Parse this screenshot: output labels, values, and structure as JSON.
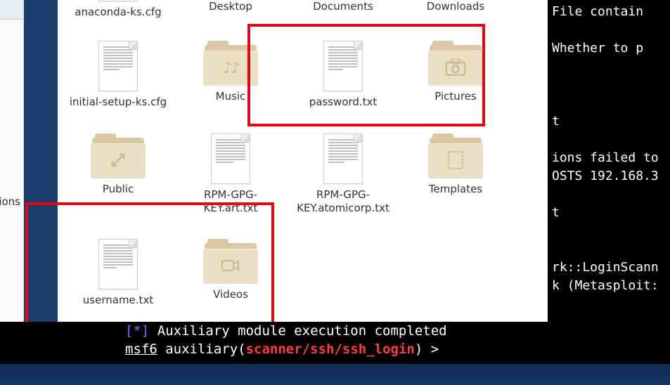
{
  "sidebar": {
    "label_fragment": "tions"
  },
  "files": {
    "r0": [
      {
        "type": "file",
        "name": "anaconda-ks.cfg"
      },
      {
        "type": "folder",
        "name": "Desktop",
        "glyph": ""
      },
      {
        "type": "folder",
        "name": "Documents",
        "glyph": ""
      },
      {
        "type": "folder",
        "name": "Downloads",
        "glyph": ""
      }
    ],
    "r1": [
      {
        "type": "file",
        "name": "initial-setup-ks.cfg"
      },
      {
        "type": "folder",
        "name": "Music",
        "glyph": "music"
      },
      {
        "type": "file",
        "name": "password.txt"
      },
      {
        "type": "folder",
        "name": "Pictures",
        "glyph": "camera"
      }
    ],
    "r2": [
      {
        "type": "folder",
        "name": "Public",
        "glyph": "share"
      },
      {
        "type": "file",
        "name": "RPM-GPG-KEY.art.txt"
      },
      {
        "type": "file",
        "name": "RPM-GPG-KEY.atomicorp.txt"
      },
      {
        "type": "folder",
        "name": "Templates",
        "glyph": "template"
      }
    ],
    "r3": [
      {
        "type": "file",
        "name": "username.txt"
      },
      {
        "type": "folder",
        "name": "Videos",
        "glyph": "video"
      }
    ]
  },
  "terminal_right": {
    "l1": "File contain",
    "l2": "",
    "l3": "Whether to p",
    "l4": "",
    "l5": "",
    "l6": "",
    "l7": "t",
    "l8": "",
    "l9": "ions failed to",
    "l10": "OSTS 192.168.3",
    "l11": "",
    "l12": "t",
    "l13": "",
    "l14": "",
    "l15": "rk::LoginScann",
    "l16": "k (Metasploit:"
  },
  "terminal_bottom": {
    "star": "[*]",
    "msg": " Auxiliary module execution completed",
    "prompt_msf": "msf6",
    "prompt_aux": " auxiliary(",
    "prompt_mod": "scanner/ssh/ssh_login",
    "prompt_end": ") > "
  }
}
